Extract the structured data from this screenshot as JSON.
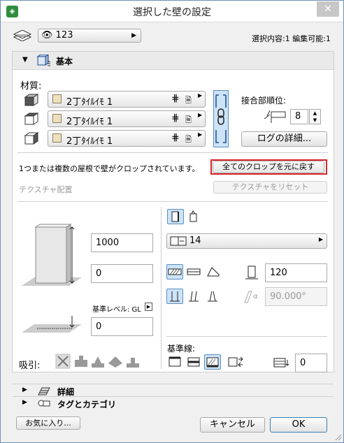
{
  "window": {
    "title": "選択した壁の設定",
    "close": "✕"
  },
  "header": {
    "layer_value": "123",
    "selection_info": "選択内容:1 編集可能:1"
  },
  "basic": {
    "section_label": "基本",
    "material_label": "材質:",
    "materials": [
      "2丁ﾀｲﾙｲﾓ 1",
      "2丁ﾀｲﾙｲﾓ 1",
      "2丁ﾀｲﾙｲﾓ 1"
    ],
    "junction_label": "接合部順位:",
    "junction_value": "8",
    "log_button": "ログの詳細..."
  },
  "crop": {
    "message": "1つまたは複数の屋根で壁がクロップされています。",
    "reset_crop_button": "全てのクロップを元に戻す",
    "texture_label": "テクスチャ配置",
    "texture_reset_button": "テクスチャをリセット"
  },
  "geometry": {
    "height": "1000",
    "offset": "0",
    "base_level_label": "基準レベル: GL",
    "base_offset": "0",
    "composite_value": "14",
    "thickness": "120",
    "angle": "90.000°",
    "alpha": "α",
    "reference_line_label": "基準線:",
    "reference_offset": "0",
    "snap_label": "吸引:"
  },
  "sections": {
    "details": "詳細",
    "tags": "タグとカテゴリ"
  },
  "footer": {
    "favorites": "お気に入り...",
    "cancel": "キャンセル",
    "ok": "OK"
  },
  "colors": {
    "accent": "#5a8fc6",
    "highlight": "#d9252b",
    "selected_bg": "#cde3f7"
  }
}
